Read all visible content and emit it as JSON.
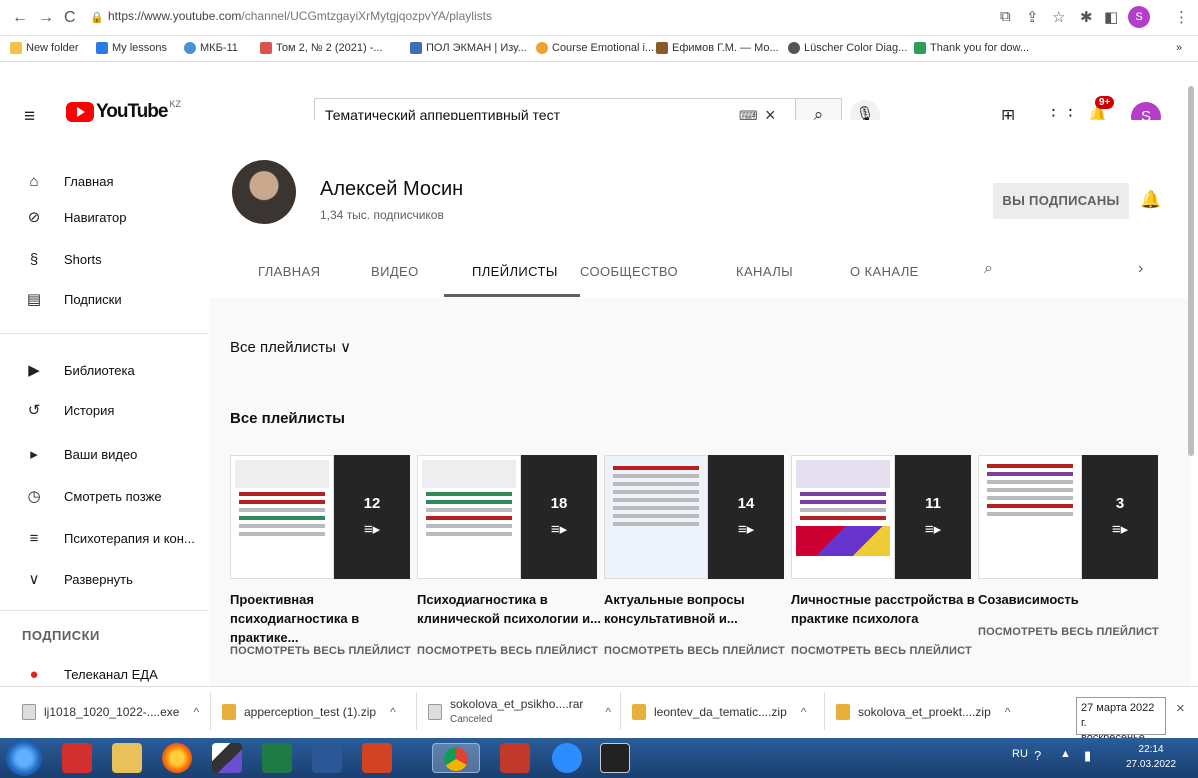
{
  "browser": {
    "url_host": "https://www.youtube.com",
    "url_path": "/channel/UCGmtzgayiXrMytgjqozpvYA/playlists",
    "bookmarks": [
      "New folder",
      "My lessons",
      "МКБ-11",
      "Том 2, № 2 (2021) -...",
      "ПОЛ ЭКМАН | Изу...",
      "Course Emotional i...",
      "Ефимов Г.М. — Мо...",
      "Lüscher Color Diag...",
      "Thank you for dow..."
    ],
    "profile_initial": "S"
  },
  "header": {
    "logo_text": "YouTube",
    "region": "KZ",
    "search_value": "Тематический апперцептивный тест",
    "notifications_badge": "9+",
    "avatar_initial": "S"
  },
  "sidebar": {
    "items": [
      {
        "label": "Главная",
        "icon": "home-icon"
      },
      {
        "label": "Навигатор",
        "icon": "compass-icon"
      },
      {
        "label": "Shorts",
        "icon": "shorts-icon"
      },
      {
        "label": "Подписки",
        "icon": "subscriptions-icon"
      },
      {
        "label": "Библиотека",
        "icon": "library-icon"
      },
      {
        "label": "История",
        "icon": "history-icon"
      },
      {
        "label": "Ваши видео",
        "icon": "your-videos-icon"
      },
      {
        "label": "Смотреть позже",
        "icon": "watch-later-icon"
      },
      {
        "label": "Психотерапия и кон...",
        "icon": "playlist-icon"
      },
      {
        "label": "Развернуть",
        "icon": "chevron-down-icon"
      }
    ],
    "subscriptions_heading": "ПОДПИСКИ",
    "subscription_item": "Телеканал ЕДА"
  },
  "channel": {
    "name": "Алексей Мосин",
    "subscribers": "1,34 тыс. подписчиков",
    "subscribed_label": "ВЫ ПОДПИСАНЫ",
    "tabs": [
      "ГЛАВНАЯ",
      "ВИДЕО",
      "ПЛЕЙЛИСТЫ",
      "СООБЩЕСТВО",
      "КАНАЛЫ",
      "О КАНАЛЕ"
    ],
    "active_tab": "ПЛЕЙЛИСТЫ"
  },
  "playlists": {
    "sort_label": "Все плейлисты",
    "section_title": "Все плейлисты",
    "view_all_label": "ПОСМОТРЕТЬ ВЕСЬ ПЛЕЙЛИСТ",
    "items": [
      {
        "title_1": "Проективная",
        "title_2": "психодиагностика в практике...",
        "count": "12"
      },
      {
        "title_1": "Психодиагностика в",
        "title_2": "клинической психологии и...",
        "count": "18"
      },
      {
        "title_1": "Актуальные вопросы",
        "title_2": "консультативной и...",
        "count": "14"
      },
      {
        "title_1": "Личностные расстройства в",
        "title_2": "практике психолога",
        "count": "11"
      },
      {
        "title_1": "Созависимость",
        "title_2": "",
        "count": "3"
      }
    ]
  },
  "downloads": [
    {
      "name": "lj1018_1020_1022-....exe",
      "status": ""
    },
    {
      "name": "apperception_test (1).zip",
      "status": ""
    },
    {
      "name": "sokolova_et_psikho....rar",
      "status": "Canceled"
    },
    {
      "name": "leontev_da_tematic....zip",
      "status": ""
    },
    {
      "name": "sokolova_et_proekt....zip",
      "status": ""
    }
  ],
  "tooltip": {
    "line1": "27 марта 2022 г.",
    "line2": "воскресенье"
  },
  "tray": {
    "lang": "RU",
    "time": "22:14",
    "date": "27.03.2022"
  }
}
